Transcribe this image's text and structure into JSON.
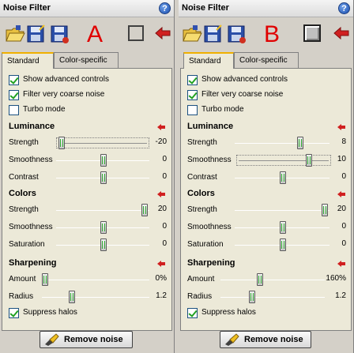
{
  "panels": [
    {
      "title": "Noise Filter",
      "overlay_letter": "A",
      "tabs": [
        "Standard",
        "Color-specific"
      ],
      "checks_top": [
        {
          "label": "Show advanced controls",
          "checked": true
        },
        {
          "label": "Filter very coarse noise",
          "checked": true
        },
        {
          "label": "Turbo mode",
          "checked": false
        }
      ],
      "luminance": {
        "heading": "Luminance",
        "strength": {
          "label": "Strength",
          "value": "-20"
        },
        "smoothness": {
          "label": "Smoothness",
          "value": "0"
        },
        "contrast": {
          "label": "Contrast",
          "value": "0"
        }
      },
      "colors": {
        "heading": "Colors",
        "strength": {
          "label": "Strength",
          "value": "20"
        },
        "smoothness": {
          "label": "Smoothness",
          "value": "0"
        },
        "saturation": {
          "label": "Saturation",
          "value": "0"
        }
      },
      "sharpening": {
        "heading": "Sharpening",
        "amount": {
          "label": "Amount",
          "value": "0%"
        },
        "radius": {
          "label": "Radius",
          "value": "1.2"
        },
        "suppress": {
          "label": "Suppress halos",
          "checked": true
        }
      },
      "remove_label": "Remove noise"
    },
    {
      "title": "Noise Filter",
      "overlay_letter": "B",
      "tabs": [
        "Standard",
        "Color-specific"
      ],
      "checks_top": [
        {
          "label": "Show advanced controls",
          "checked": true
        },
        {
          "label": "Filter very coarse noise",
          "checked": true
        },
        {
          "label": "Turbo mode",
          "checked": false
        }
      ],
      "luminance": {
        "heading": "Luminance",
        "strength": {
          "label": "Strength",
          "value": "8"
        },
        "smoothness": {
          "label": "Smoothness",
          "value": "10"
        },
        "contrast": {
          "label": "Contrast",
          "value": "0"
        }
      },
      "colors": {
        "heading": "Colors",
        "strength": {
          "label": "Strength",
          "value": "20"
        },
        "smoothness": {
          "label": "Smoothness",
          "value": "0"
        },
        "saturation": {
          "label": "Saturation",
          "value": "0"
        }
      },
      "sharpening": {
        "heading": "Sharpening",
        "amount": {
          "label": "Amount",
          "value": "160%"
        },
        "radius": {
          "label": "Radius",
          "value": "1.2"
        },
        "suppress": {
          "label": "Suppress halos",
          "checked": true
        }
      },
      "remove_label": "Remove noise"
    }
  ],
  "icons": {
    "help": "?",
    "open": "folder-open-icon",
    "save": "save-icon",
    "save_as": "save-as-icon",
    "view": "split-view-icon",
    "reset": "red-arrow-icon"
  },
  "colors": {
    "accent_red": "#e00000",
    "check_green": "#21a121",
    "tab_highlight": "#f0b000"
  }
}
